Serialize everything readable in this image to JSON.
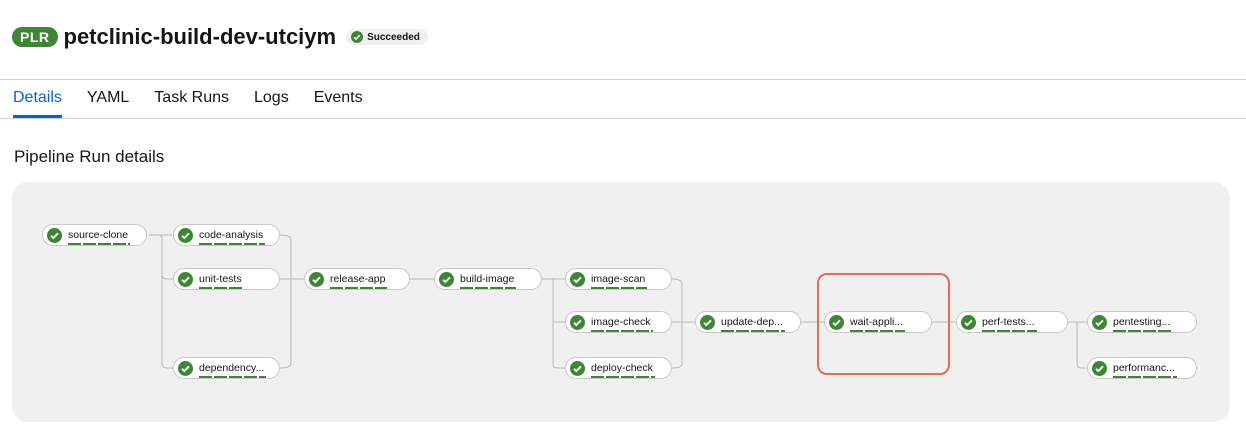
{
  "header": {
    "kind": "PLR",
    "title": "petclinic-build-dev-utciym",
    "status": "Succeeded",
    "status_color": "#3e8635"
  },
  "tabs": [
    {
      "label": "Details",
      "active": true
    },
    {
      "label": "YAML",
      "active": false
    },
    {
      "label": "Task Runs",
      "active": false
    },
    {
      "label": "Logs",
      "active": false
    },
    {
      "label": "Events",
      "active": false
    }
  ],
  "section_title": "Pipeline Run details",
  "tasks": {
    "source_clone": "source-clone",
    "code_analysis": "code-analysis",
    "unit_tests": "unit-tests",
    "dependency": "dependency...",
    "release_app": "release-app",
    "build_image": "build-image",
    "image_scan": "image-scan",
    "image_check": "image-check",
    "deploy_check": "deploy-check",
    "update_dep": "update-dep...",
    "wait_appli": "wait-appli...",
    "perf_tests": "perf-tests...",
    "pentesting": "pentesting...",
    "performanc": "performanc..."
  },
  "task_status": "succeeded",
  "icons": {
    "task": "check-circle-icon"
  },
  "colors": {
    "success": "#3e8635",
    "accent": "#0066cc",
    "highlight": "#e06d55"
  }
}
